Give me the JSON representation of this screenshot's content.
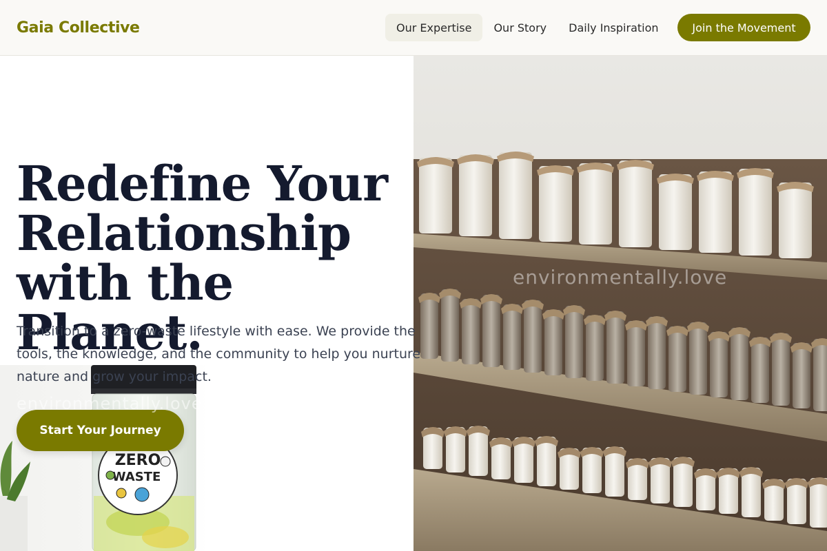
{
  "brand": {
    "name": "Gaia Collective",
    "accent": "#7a7a00"
  },
  "nav": {
    "items": [
      "Our Expertise",
      "Our Story",
      "Daily Inspiration"
    ],
    "cta": "Join the Movement"
  },
  "hero": {
    "headline_lines": [
      "Redefine Your",
      "Relationship",
      "with the Planet."
    ],
    "subcopy": "Transition to a zero-waste lifestyle with ease. We provide the tools, the knowledge, and the community to help you nurture nature and grow your impact.",
    "cta": "Start Your Journey"
  },
  "images": {
    "pantry_watermark": "environmentally.love",
    "bottle_watermark": "environmentally.love",
    "sticker_text_1": "ZERO",
    "sticker_text_2": "WASTE"
  },
  "colors": {
    "heading": "#141a2e",
    "body_text": "#3b4252",
    "header_bg": "#faf9f6",
    "nav_active_bg": "#f0efe6"
  }
}
